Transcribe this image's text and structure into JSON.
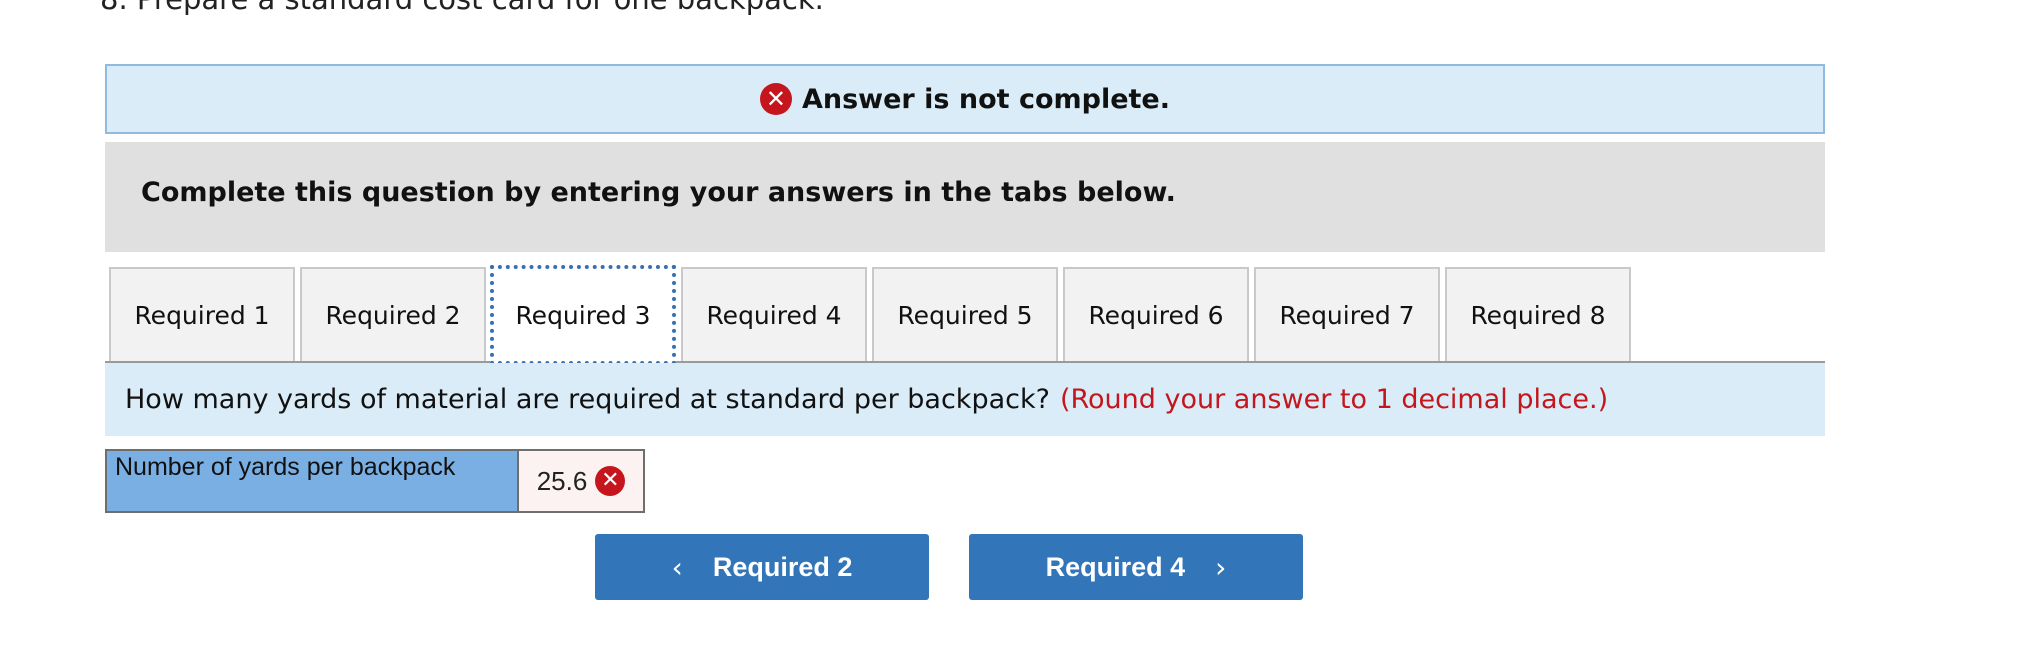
{
  "question": {
    "header_line": "8. Prepare a standard cost card for one backpack."
  },
  "status_banner": {
    "icon": "x-circle-icon",
    "text": "Answer is not complete."
  },
  "instructions": "Complete this question by entering your answers in the tabs below.",
  "tabs": [
    {
      "label": "Required 1",
      "active": false
    },
    {
      "label": "Required 2",
      "active": false
    },
    {
      "label": "Required 3",
      "active": true
    },
    {
      "label": "Required 4",
      "active": false
    },
    {
      "label": "Required 5",
      "active": false
    },
    {
      "label": "Required 6",
      "active": false
    },
    {
      "label": "Required 7",
      "active": false
    },
    {
      "label": "Required 8",
      "active": false
    }
  ],
  "prompt": {
    "text": "How many yards of material are required at standard per backpack?",
    "hint": "(Round your answer to 1 decimal place.)"
  },
  "answer_row": {
    "label": "Number of yards per backpack",
    "value": "25.6",
    "status_icon": "x-circle-icon"
  },
  "navigation": {
    "prev_label": "Required 2",
    "next_label": "Required 4"
  },
  "colors": {
    "banner_bg": "#d9ecf8",
    "error_red": "#c4161c",
    "button_blue": "#3375b9",
    "label_cell_blue": "#7aafe3"
  }
}
